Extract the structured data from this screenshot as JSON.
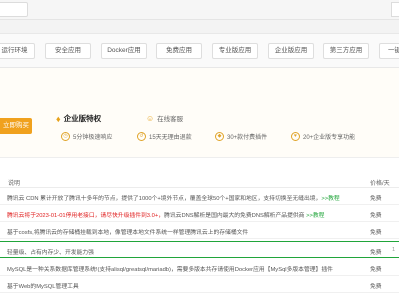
{
  "categories": [
    "运行环境",
    "安全应用",
    "Docker应用",
    "免费应用",
    "专业版应用",
    "企业版应用",
    "第三方应用",
    "一键"
  ],
  "promo": {
    "buy_label": "立即购买",
    "enterprise_title": "企业版特权",
    "online_service": "在线客服",
    "features": [
      "5分钟极速响应",
      "15天无理由退款",
      "30+款付费插件",
      "20+企业版专享功能"
    ]
  },
  "table": {
    "col_desc": "说明",
    "col_price": "价格/天",
    "rows": [
      {
        "desc_main": "腾讯云 CDN 累计开放了腾讯十多年的节点，提供了1000个+境外节点，覆盖全球50个+国家和地区，支持切换至无缝出境，",
        "desc_link": ">>教程",
        "desc_red": "",
        "price": "免费",
        "more": ""
      },
      {
        "desc_red": "腾讯云将于2023-01-01停用老接口，请尽快升级插件到3.0+，",
        "desc_main": "腾讯云DNS解析是国内最大的免费DNS解析产品提供商 ",
        "desc_link": ">>教程",
        "price": "免费",
        "more": ""
      },
      {
        "desc_main": "基于cosfs,将腾讯云的存储桶挂载到本地，像管理本地文件系统一样管理腾讯云上的存储桶文件",
        "desc_link": "",
        "desc_red": "",
        "price": "免费",
        "more": ""
      },
      {
        "desc_main": "轻量级、占有内存少、开发能力强",
        "desc_link": "",
        "desc_red": "",
        "price": "免费",
        "more": "1"
      },
      {
        "desc_main": "MySQL是一种关系数据库管理系统!(支持alisql/greatsql/mariadb)，需要多版本共存请使用Docker应用【MySql多版本管理】插件",
        "desc_link": "",
        "desc_red": "",
        "price": "免费",
        "more": ""
      },
      {
        "desc_main": "基于Web的MySQL管理工具",
        "desc_link": "",
        "desc_red": "",
        "price": "免费",
        "more": ""
      }
    ]
  }
}
